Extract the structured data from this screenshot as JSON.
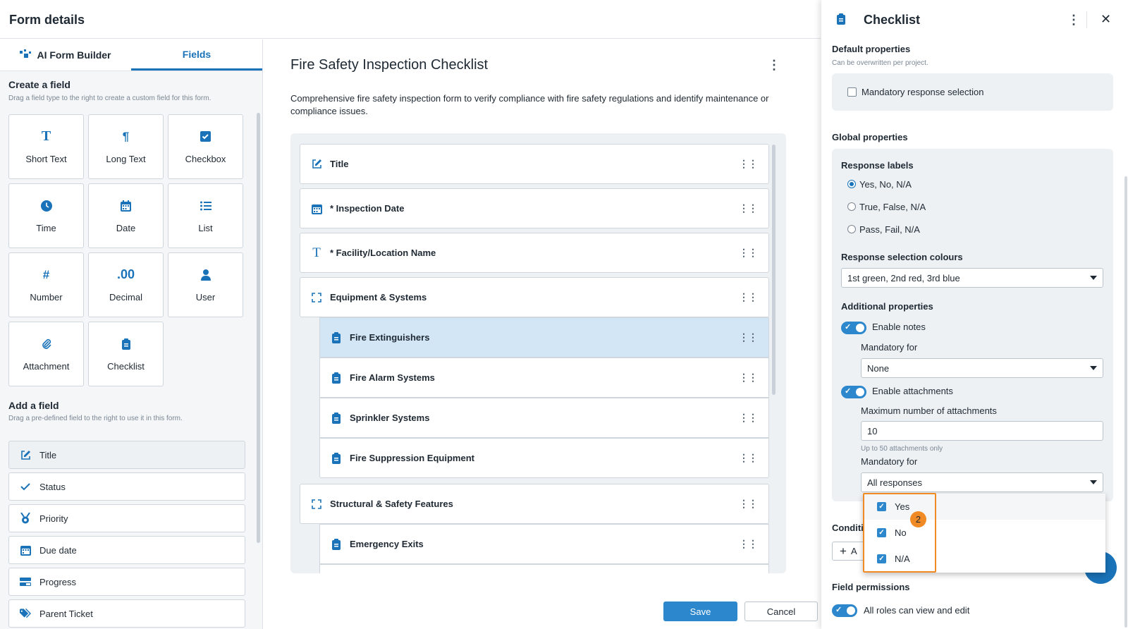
{
  "header": {
    "title": "Form details"
  },
  "left": {
    "tabs": [
      {
        "label": "AI Form Builder"
      },
      {
        "label": "Fields"
      }
    ],
    "create": {
      "title": "Create a field",
      "subtitle": "Drag a field type to the right to create a custom field for this form."
    },
    "field_types": [
      {
        "label": "Short Text",
        "icon": "text-icon"
      },
      {
        "label": "Long Text",
        "icon": "paragraph-icon"
      },
      {
        "label": "Checkbox",
        "icon": "checkbox-icon"
      },
      {
        "label": "Time",
        "icon": "clock-icon"
      },
      {
        "label": "Date",
        "icon": "calendar-icon"
      },
      {
        "label": "List",
        "icon": "list-icon"
      },
      {
        "label": "Number",
        "icon": "hash-icon"
      },
      {
        "label": "Decimal",
        "icon": "decimal-icon"
      },
      {
        "label": "User",
        "icon": "user-icon"
      },
      {
        "label": "Attachment",
        "icon": "paperclip-icon"
      },
      {
        "label": "Checklist",
        "icon": "clipboard-icon"
      }
    ],
    "add": {
      "title": "Add a field",
      "subtitle": "Drag a pre-defined field to the right to use it in this form."
    },
    "predefined": [
      {
        "label": "Title",
        "icon": "edit-icon"
      },
      {
        "label": "Status",
        "icon": "check-icon"
      },
      {
        "label": "Priority",
        "icon": "medal-icon"
      },
      {
        "label": "Due date",
        "icon": "calendar-icon"
      },
      {
        "label": "Progress",
        "icon": "progress-icon"
      },
      {
        "label": "Parent Ticket",
        "icon": "tags-icon"
      }
    ]
  },
  "form": {
    "title": "Fire Safety Inspection Checklist",
    "description": "Comprehensive fire safety inspection form to verify compliance with fire safety regulations and identify maintenance or compliance issues.",
    "fields": [
      {
        "label": "Title",
        "icon": "edit-icon"
      },
      {
        "label": "* Inspection Date",
        "icon": "calendar-icon"
      },
      {
        "label": "* Facility/Location Name",
        "icon": "text-icon"
      },
      {
        "label": "Equipment & Systems",
        "icon": "section-icon"
      },
      {
        "label": "Fire Extinguishers",
        "icon": "clipboard-icon"
      },
      {
        "label": "Fire Alarm Systems",
        "icon": "clipboard-icon"
      },
      {
        "label": "Sprinkler Systems",
        "icon": "clipboard-icon"
      },
      {
        "label": "Fire Suppression Equipment",
        "icon": "clipboard-icon"
      },
      {
        "label": "Structural & Safety Features",
        "icon": "section-icon"
      },
      {
        "label": "Emergency Exits",
        "icon": "clipboard-icon"
      }
    ],
    "save_label": "Save",
    "cancel_label": "Cancel"
  },
  "panel": {
    "title": "Checklist",
    "default_props": {
      "title": "Default properties",
      "subtitle": "Can be overwritten per project.",
      "mandatory_label": "Mandatory response selection"
    },
    "global_props": {
      "title": "Global properties"
    },
    "response_labels": {
      "title": "Response labels",
      "options": [
        "Yes, No, N/A",
        "True, False, N/A",
        "Pass, Fail, N/A"
      ]
    },
    "colours": {
      "title": "Response selection colours",
      "value": "1st green, 2nd red, 3rd blue"
    },
    "additional": {
      "title": "Additional properties"
    },
    "notes": {
      "label": "Enable notes",
      "mandatory_for_label": "Mandatory for",
      "mandatory_for_value": "None"
    },
    "attachments": {
      "label": "Enable attachments",
      "max_label": "Maximum number of attachments",
      "max_value": "10",
      "max_hint": "Up to 50 attachments only",
      "mandatory_for_label": "Mandatory for",
      "mandatory_for_value": "All responses"
    },
    "conditions_label": "Conditi",
    "add_button_label": "A",
    "permissions": {
      "title": "Field permissions",
      "label": "All roles can view and edit"
    }
  },
  "dropdown": {
    "options": [
      "Yes",
      "No",
      "N/A"
    ],
    "badge": "2"
  }
}
